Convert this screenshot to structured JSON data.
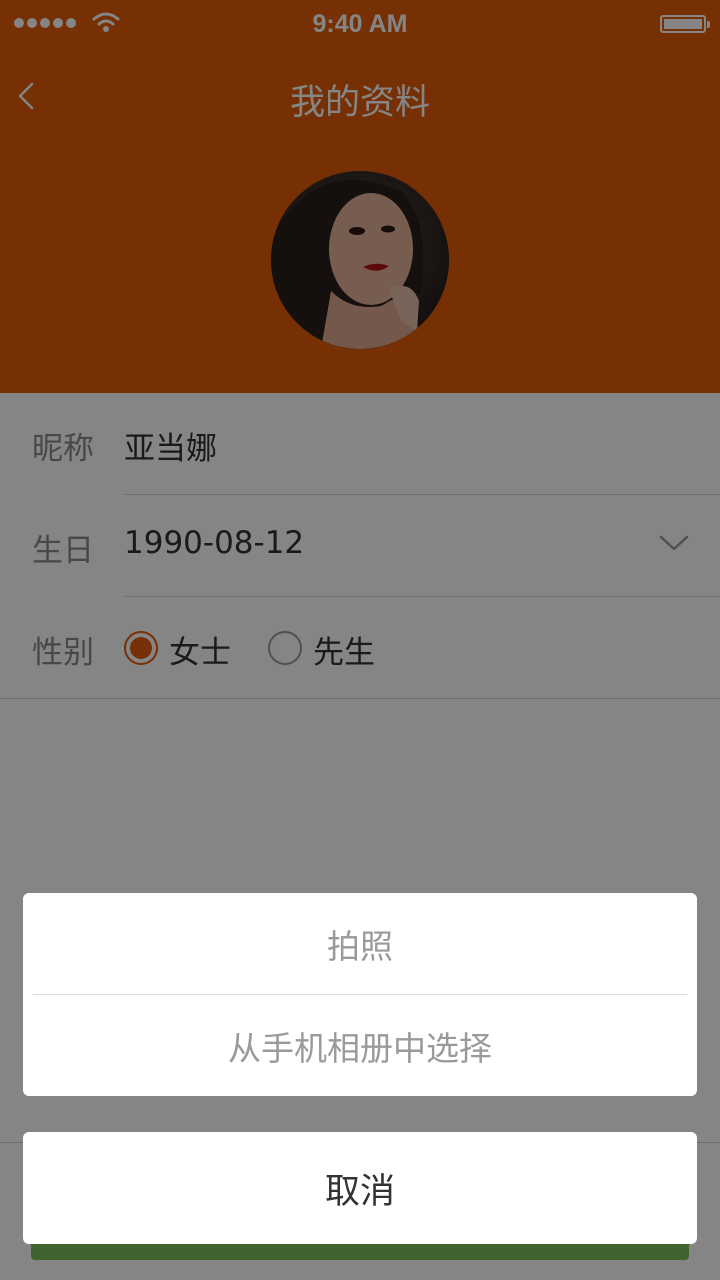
{
  "status_bar": {
    "time": "9:40 AM",
    "signal_icon": "signal-dots-icon",
    "wifi_icon": "wifi-icon",
    "battery_icon": "battery-icon",
    "battery_level": 1.0
  },
  "header": {
    "title": "我的资料",
    "back_icon": "chevron-left-icon",
    "background_color": "#e35d06"
  },
  "profile": {
    "avatar_alt": "avatar-photo"
  },
  "form": {
    "nickname": {
      "label": "昵称",
      "value": "亚当娜"
    },
    "birthday": {
      "label": "生日",
      "value": "1990-08-12",
      "dropdown_icon": "chevron-down-icon"
    },
    "gender": {
      "label": "性别",
      "options": [
        {
          "label": "女士",
          "selected": true
        },
        {
          "label": "先生",
          "selected": false
        }
      ]
    }
  },
  "action_sheet": {
    "options": [
      {
        "label": "拍照"
      },
      {
        "label": "从手机相册中选择"
      }
    ],
    "cancel_label": "取消"
  },
  "colors": {
    "accent": "#e35d06",
    "save_button": "#7dbf5a"
  }
}
